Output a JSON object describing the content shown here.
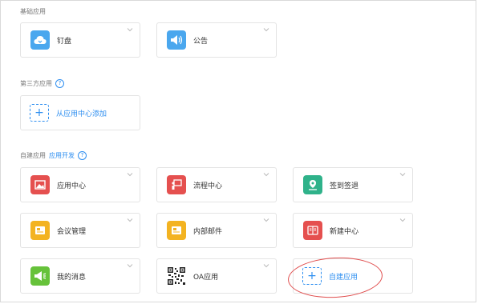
{
  "sections": {
    "basic": {
      "title": "基础应用"
    },
    "third_party": {
      "title": "第三方应用",
      "help": "?"
    },
    "custom": {
      "title": "自建应用",
      "dev_link": "应用开发",
      "help": "?"
    }
  },
  "basic_apps": [
    {
      "label": "钉盘",
      "icon": "cloud-icon",
      "color": "#4aa7ee"
    },
    {
      "label": "公告",
      "icon": "megaphone-icon",
      "color": "#4aa7ee"
    }
  ],
  "third_party_add": {
    "label": "从应用中心添加",
    "icon": "plus-icon"
  },
  "custom_apps": [
    {
      "label": "应用中心",
      "icon": "gallery-icon",
      "color": "#e5504f"
    },
    {
      "label": "流程中心",
      "icon": "presentation-icon",
      "color": "#e5504f"
    },
    {
      "label": "签到签退",
      "icon": "map-pin-icon",
      "color": "#2fb28a"
    },
    {
      "label": "会议管理",
      "icon": "document-icon",
      "color": "#f3b321"
    },
    {
      "label": "内部邮件",
      "icon": "mail-icon",
      "color": "#f3b321"
    },
    {
      "label": "新建中心",
      "icon": "book-icon",
      "color": "#e5504f"
    },
    {
      "label": "我的消息",
      "icon": "megaphone-icon",
      "color": "#66c23a"
    },
    {
      "label": "OA应用",
      "icon": "qrcode-icon",
      "color": "#333333"
    }
  ],
  "custom_add": {
    "label": "自建应用",
    "icon": "plus-icon"
  },
  "colors": {
    "accent": "#2f8ff0",
    "highlight": "#e04e4e"
  }
}
